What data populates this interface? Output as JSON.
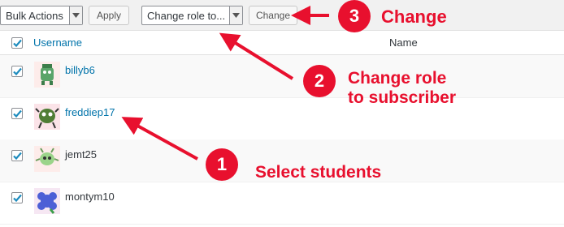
{
  "toolbar": {
    "bulk_actions": {
      "selected": "Bulk Actions"
    },
    "apply_label": "Apply",
    "change_role": {
      "selected": "Change role to..."
    },
    "change_label": "Change"
  },
  "table": {
    "columns": [
      "Username",
      "Name"
    ],
    "rows": [
      {
        "username": "billyb6",
        "checked": true,
        "link": true
      },
      {
        "username": "freddiep17",
        "checked": true,
        "link": true
      },
      {
        "username": "jemt25",
        "checked": true,
        "link": false
      },
      {
        "username": "montym10",
        "checked": true,
        "link": false
      }
    ]
  },
  "annotations": [
    {
      "number": "1",
      "text": "Select students"
    },
    {
      "number": "2",
      "text_line1": "Change role",
      "text_line2": "to subscriber"
    },
    {
      "number": "3",
      "text": "Change"
    }
  ],
  "colors": {
    "accent_red": "#e8102e",
    "link_blue": "#0073aa"
  },
  "icons": [
    "chevron-down-icon",
    "checkmark-icon",
    "avatar-icon"
  ]
}
